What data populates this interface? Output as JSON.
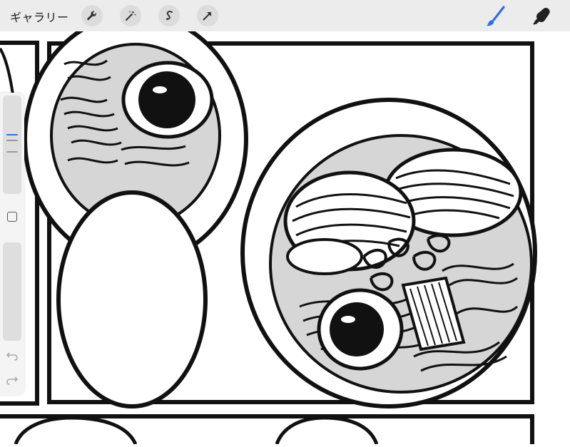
{
  "toolbar": {
    "gallery_label": "ギャラリー",
    "tools": [
      "wrench-icon",
      "magic-wand-icon",
      "selection-s-icon",
      "transform-arrow-icon"
    ],
    "active_tool": "brush",
    "right_tools": [
      "brush-icon",
      "smudge-icon"
    ]
  },
  "colors": {
    "toolbar_bg": "#ececec",
    "accent": "#2f6fe0",
    "ink": "#111111",
    "plate_gray": "#d6d6d6"
  },
  "sidebar": {
    "controls": [
      "brush-size-slider",
      "modify-button",
      "opacity-slider",
      "undo-button",
      "redo-button"
    ]
  }
}
